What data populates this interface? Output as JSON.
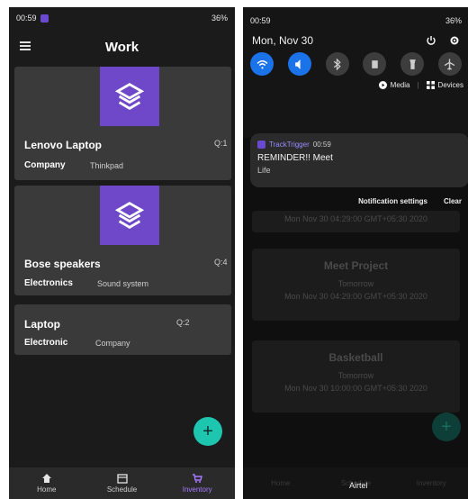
{
  "left": {
    "status": {
      "time": "00:59",
      "battery": "36%"
    },
    "title": "Work",
    "items": [
      {
        "name": "Lenovo Laptop",
        "qty": "Q:1",
        "category": "Company",
        "desc": "Thinkpad"
      },
      {
        "name": "Bose speakers",
        "qty": "Q:4",
        "category": "Electronics",
        "desc": "Sound system"
      },
      {
        "name": "Laptop",
        "qty": "Q:2",
        "category": "Electronic",
        "desc": "Company"
      }
    ],
    "fab": "+",
    "nav": [
      {
        "label": "Home",
        "icon": "home-icon"
      },
      {
        "label": "Schedule",
        "icon": "calendar-icon"
      },
      {
        "label": "Inventory",
        "icon": "cart-icon"
      }
    ],
    "colors": {
      "accent": "#a77bff",
      "fab": "#1ec6b0",
      "thumb": "#6e48c8"
    }
  },
  "right": {
    "status": {
      "time": "00:59",
      "battery": "36%"
    },
    "date": "Mon, Nov 30",
    "media_label": "Media",
    "devices_label": "Devices",
    "notification": {
      "app": "TrackTrigger",
      "time": "00:59",
      "title": "REMINDER!! Meet",
      "text": "Life"
    },
    "notification_settings": "Notification settings",
    "clear": "Clear",
    "partial_text": "Mon Nov 30 04:29:00 GMT+05:30 2020",
    "events": [
      {
        "title": "Meet Project",
        "when": "Tomorrow",
        "date": "Mon Nov 30 04:29:00 GMT+05:30 2020"
      },
      {
        "title": "Basketball",
        "when": "Tomorrow",
        "date": "Mon Nov 30 10:00:00 GMT+05:30 2020"
      }
    ],
    "toast": "Airtel",
    "nav": [
      "Home",
      "Schedule",
      "Inventory"
    ]
  }
}
